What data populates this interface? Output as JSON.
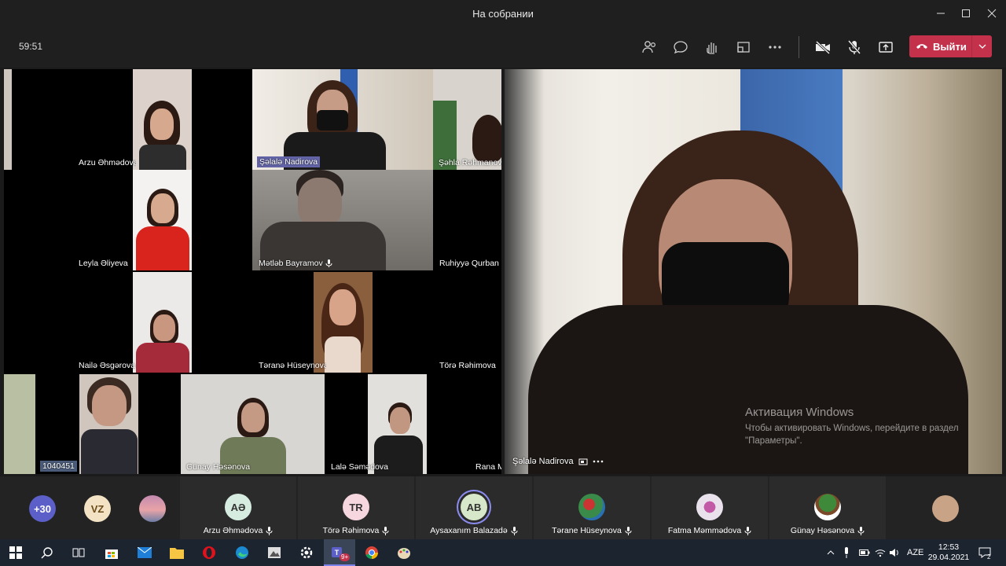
{
  "window": {
    "title": "На собрании"
  },
  "toolbar": {
    "timer": "59:51",
    "leave_label": "Выйти"
  },
  "grid": {
    "tiles": [
      {
        "name": "Arzu Əhmədova"
      },
      {
        "name": "Şəlalə Nadirova"
      },
      {
        "name": "Şəhla Rəhmanov"
      },
      {
        "name": "Leyla Əliyeva"
      },
      {
        "name": "Mətləb Bayramov"
      },
      {
        "name": "Ruhiyyə Qurban"
      },
      {
        "name": "Nailə Əsgərova"
      },
      {
        "name": "Təranə Hüseynova"
      },
      {
        "name": "Törə Rəhimova"
      },
      {
        "name": "1040451"
      },
      {
        "name": "Günay Həsənova"
      },
      {
        "name": "Lalə Səmədova"
      },
      {
        "name": "Rana M"
      }
    ]
  },
  "spotlight": {
    "name": "Şəlalə Nadirova"
  },
  "activation": {
    "title": "Активация Windows",
    "line1": "Чтобы активировать Windows, перейдите в раздел",
    "line2": "\"Параметры\"."
  },
  "roster": {
    "overflow": "+30",
    "vz": "VZ",
    "people": [
      {
        "initials": "AƏ",
        "name": "Arzu Əhmədova",
        "color": "#d6ece1"
      },
      {
        "initials": "TR",
        "name": "Törə Rəhimova",
        "color": "#f6d6df"
      },
      {
        "initials": "AB",
        "name": "Aysaxanım Balazadə",
        "color": "#d7e7c9"
      },
      {
        "initials": "",
        "name": "Tərane Hüseynova",
        "color": "#7a9a6a"
      },
      {
        "initials": "",
        "name": "Fatma Məmmədova",
        "color": "#e6e0e8"
      },
      {
        "initials": "",
        "name": "Günay Həsənova",
        "color": "#ffffff"
      }
    ]
  },
  "taskbar": {
    "lang": "AZE",
    "time": "12:53",
    "date": "29.04.2021",
    "teams_badge": "9+",
    "notif_count": "2"
  }
}
